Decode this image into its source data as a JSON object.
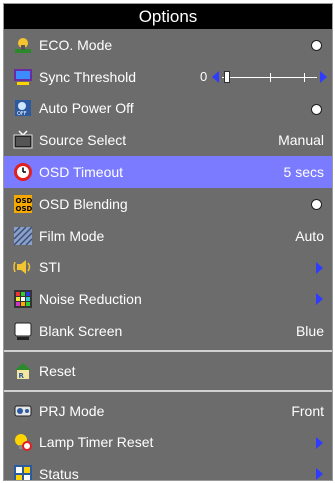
{
  "title": "Options",
  "menu": {
    "eco_mode": {
      "label": "ECO. Mode",
      "icon": "eco-mode-icon"
    },
    "sync_threshold": {
      "label": "Sync Threshold",
      "value": "0",
      "level": 0,
      "icon": "sync-threshold-icon"
    },
    "auto_power_off": {
      "label": "Auto Power Off",
      "icon": "auto-power-off-icon"
    },
    "source_select": {
      "label": "Source Select",
      "value": "Manual",
      "icon": "source-select-icon"
    },
    "osd_timeout": {
      "label": "OSD Timeout",
      "value": "5 secs",
      "icon": "clock-icon"
    },
    "osd_blending": {
      "label": "OSD Blending",
      "icon": "osd-blending-icon"
    },
    "film_mode": {
      "label": "Film Mode",
      "value": "Auto",
      "icon": "film-mode-icon"
    },
    "sti": {
      "label": "STI",
      "icon": "sti-icon"
    },
    "noise_reduction": {
      "label": "Noise Reduction",
      "icon": "noise-reduction-icon"
    },
    "blank_screen": {
      "label": "Blank Screen",
      "value": "Blue",
      "icon": "blank-screen-icon"
    },
    "reset": {
      "label": "Reset",
      "icon": "reset-icon"
    },
    "prj_mode": {
      "label": "PRJ Mode",
      "value": "Front",
      "icon": "projector-icon"
    },
    "lamp_timer_reset": {
      "label": "Lamp Timer Reset",
      "icon": "lamp-timer-icon"
    },
    "status": {
      "label": "Status",
      "icon": "status-icon"
    }
  },
  "colors": {
    "background": "#6c6c6c",
    "title_bar": "#000000",
    "selected_row": "#7b7bff",
    "arrow": "#2f3bff"
  }
}
